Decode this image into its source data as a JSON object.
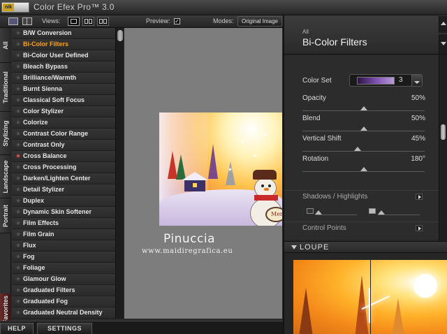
{
  "app": {
    "logo": "nik",
    "title": "Color Efex Pro™ 3.0"
  },
  "toolbar": {
    "views_label": "Views:",
    "preview_label": "Preview:",
    "preview_checked": true,
    "modes_label": "Modes:",
    "mode_value": "Original Image"
  },
  "category_tabs": {
    "all": "All",
    "traditional": "Traditional",
    "stylizing": "Stylizing",
    "landscape": "Landscape",
    "portrait": "Portrait",
    "favorites": "Favorites"
  },
  "filters": [
    {
      "name": "B/W Conversion",
      "selected": false,
      "favorite": false
    },
    {
      "name": "Bi-Color Filters",
      "selected": true,
      "favorite": false
    },
    {
      "name": "Bi-Color User Defined",
      "selected": false,
      "favorite": false
    },
    {
      "name": "Bleach Bypass",
      "selected": false,
      "favorite": false
    },
    {
      "name": "Brilliance/Warmth",
      "selected": false,
      "favorite": false
    },
    {
      "name": "Burnt Sienna",
      "selected": false,
      "favorite": false
    },
    {
      "name": "Classical Soft Focus",
      "selected": false,
      "favorite": false
    },
    {
      "name": "Color Stylizer",
      "selected": false,
      "favorite": false
    },
    {
      "name": "Colorize",
      "selected": false,
      "favorite": false
    },
    {
      "name": "Contrast Color Range",
      "selected": false,
      "favorite": false
    },
    {
      "name": "Contrast Only",
      "selected": false,
      "favorite": false
    },
    {
      "name": "Cross Balance",
      "selected": false,
      "favorite": true
    },
    {
      "name": "Cross Processing",
      "selected": false,
      "favorite": false
    },
    {
      "name": "Darken/Lighten Center",
      "selected": false,
      "favorite": false
    },
    {
      "name": "Detail Stylizer",
      "selected": false,
      "favorite": false
    },
    {
      "name": "Duplex",
      "selected": false,
      "favorite": false
    },
    {
      "name": "Dynamic Skin Softener",
      "selected": false,
      "favorite": false
    },
    {
      "name": "Film Effects",
      "selected": false,
      "favorite": false
    },
    {
      "name": "Film Grain",
      "selected": false,
      "favorite": false
    },
    {
      "name": "Flux",
      "selected": false,
      "favorite": false
    },
    {
      "name": "Fog",
      "selected": false,
      "favorite": false
    },
    {
      "name": "Foliage",
      "selected": false,
      "favorite": false
    },
    {
      "name": "Glamour Glow",
      "selected": false,
      "favorite": false
    },
    {
      "name": "Graduated Filters",
      "selected": false,
      "favorite": false
    },
    {
      "name": "Graduated Fog",
      "selected": false,
      "favorite": false
    },
    {
      "name": "Graduated Neutral Density",
      "selected": false,
      "favorite": false
    }
  ],
  "bottom": {
    "help": "HELP",
    "settings": "SETTINGS"
  },
  "preview": {
    "watermark_name": "Pinuccia",
    "watermark_url": "www.maidiregrafica.eu",
    "sign_text": "Merr"
  },
  "panel": {
    "category": "All",
    "title": "Bi-Color Filters",
    "color_set": {
      "label": "Color Set",
      "value": "3"
    },
    "sliders": [
      {
        "label": "Opacity",
        "value": "50%",
        "level": 0.5
      },
      {
        "label": "Blend",
        "value": "50%",
        "level": 0.5
      },
      {
        "label": "Vertical Shift",
        "value": "45%",
        "level": 0.45
      },
      {
        "label": "Rotation",
        "value": "180°",
        "level": 0.5
      }
    ],
    "shadows_highlights": "Shadows / Highlights",
    "control_points": "Control Points",
    "loupe": "LOUPE"
  },
  "colors": {
    "accent": "#f6a21c",
    "favorite_star": "#e05050",
    "color_set_gradient_start": "#2a1440",
    "color_set_gradient_end": "#b89ad8"
  },
  "icons": {
    "layout1": "single-panel-icon",
    "layout2": "dual-panel-icon",
    "star": "star-icon",
    "checkbox": "check-icon"
  }
}
